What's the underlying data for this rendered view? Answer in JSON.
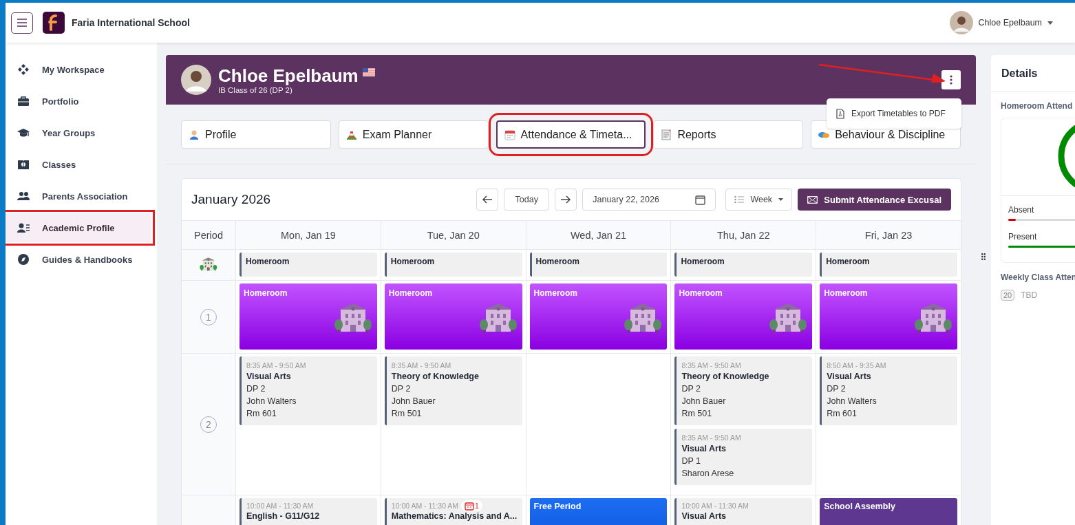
{
  "app_bar": {
    "school": "Faria International School",
    "user": "Chloe Epelbaum"
  },
  "sidebar": {
    "items": [
      {
        "label": "My Workspace",
        "selected": false,
        "annotated": false
      },
      {
        "label": "Portfolio",
        "selected": false,
        "annotated": false
      },
      {
        "label": "Year Groups",
        "selected": false,
        "annotated": false
      },
      {
        "label": "Classes",
        "selected": false,
        "annotated": false
      },
      {
        "label": "Parents Association",
        "selected": false,
        "annotated": false
      },
      {
        "label": "Academic Profile",
        "selected": true,
        "annotated": true
      },
      {
        "label": "Guides & Handbooks",
        "selected": false,
        "annotated": false
      }
    ]
  },
  "student": {
    "name": "Chloe Epelbaum",
    "subtitle": "IB Class of 26 (DP 2)",
    "more_button_annotated": true,
    "menu": {
      "items": [
        "Export Timetables to PDF"
      ]
    }
  },
  "tabs": [
    {
      "label": "Profile",
      "selected": false,
      "annotated": false
    },
    {
      "label": "Exam Planner",
      "selected": false,
      "annotated": false
    },
    {
      "label": "Attendance & Timeta...",
      "selected": true,
      "annotated": true
    },
    {
      "label": "Reports",
      "selected": false,
      "annotated": false
    },
    {
      "label": "Behaviour & Discipline",
      "selected": false,
      "annotated": false
    }
  ],
  "calendar": {
    "title": "January 2026",
    "today_button": "Today",
    "date": "January 22, 2026",
    "view": "Week",
    "submit_button": "Submit Attendance Excusal",
    "columns": [
      "Period",
      "Mon, Jan 19",
      "Tue, Jan 20",
      "Wed, Jan 21",
      "Thu, Jan 22",
      "Fri, Jan 23"
    ],
    "rows": [
      {
        "kind": "homeroom",
        "cells": [
          [
            {
              "kind": "plain",
              "title": "Homeroom"
            }
          ],
          [
            {
              "kind": "plain",
              "title": "Homeroom"
            }
          ],
          [
            {
              "kind": "plain",
              "title": "Homeroom"
            }
          ],
          [
            {
              "kind": "plain",
              "title": "Homeroom"
            }
          ],
          [
            {
              "kind": "plain",
              "title": "Homeroom"
            }
          ]
        ]
      },
      {
        "kind": "period",
        "period": "1",
        "cells": [
          [
            {
              "kind": "homeroom",
              "title": "Homeroom"
            }
          ],
          [
            {
              "kind": "homeroom",
              "title": "Homeroom"
            }
          ],
          [
            {
              "kind": "homeroom",
              "title": "Homeroom"
            }
          ],
          [
            {
              "kind": "homeroom",
              "title": "Homeroom"
            }
          ],
          [
            {
              "kind": "homeroom",
              "title": "Homeroom"
            }
          ]
        ]
      },
      {
        "kind": "period",
        "period": "2",
        "cells": [
          [
            {
              "kind": "class",
              "time": "8:35 AM - 9:50 AM",
              "title": "Visual Arts",
              "lines": [
                "DP 2",
                "John Walters",
                "Rm 601"
              ]
            }
          ],
          [
            {
              "kind": "class",
              "time": "8:35 AM - 9:50 AM",
              "title": "Theory of Knowledge",
              "lines": [
                "DP 2",
                "John Bauer",
                "Rm 501"
              ]
            }
          ],
          [],
          [
            {
              "kind": "class",
              "time": "8:35 AM - 9:50 AM",
              "title": "Theory of Knowledge",
              "lines": [
                "DP 2",
                "John Bauer",
                "Rm 501"
              ]
            },
            {
              "kind": "class",
              "time": "8:35 AM - 9:50 AM",
              "title": "Visual Arts",
              "lines": [
                "DP 1",
                "Sharon Arese"
              ]
            }
          ],
          [
            {
              "kind": "class",
              "time": "8:50 AM - 9:35 AM",
              "title": "Visual Arts",
              "lines": [
                "DP 2",
                "John Walters",
                "Rm 601"
              ]
            }
          ]
        ]
      },
      {
        "kind": "period",
        "cells": [
          [
            {
              "kind": "class",
              "time": "10:00 AM - 11:30 AM",
              "title": "English - G11/G12"
            }
          ],
          [
            {
              "kind": "class",
              "time": "10:00 AM - 11:30 AM",
              "title": "Mathematics: Analysis and A...",
              "badge": "1"
            }
          ],
          [
            {
              "kind": "free",
              "title": "Free Period"
            }
          ],
          [
            {
              "kind": "class",
              "time": "10:00 AM - 11:30 AM",
              "title": "Visual Arts"
            }
          ],
          [
            {
              "kind": "assembly",
              "title": "School Assembly"
            }
          ]
        ]
      }
    ]
  },
  "details": {
    "title": "Details",
    "section": "Homeroom Attend",
    "bars": [
      {
        "kind": "absent",
        "label": "Absent",
        "level": 0.04
      },
      {
        "kind": "present",
        "label": "Present",
        "level": 0.96
      }
    ],
    "weekly": {
      "label": "Weekly Class Atten",
      "count": "20",
      "status": "TBD"
    }
  }
}
